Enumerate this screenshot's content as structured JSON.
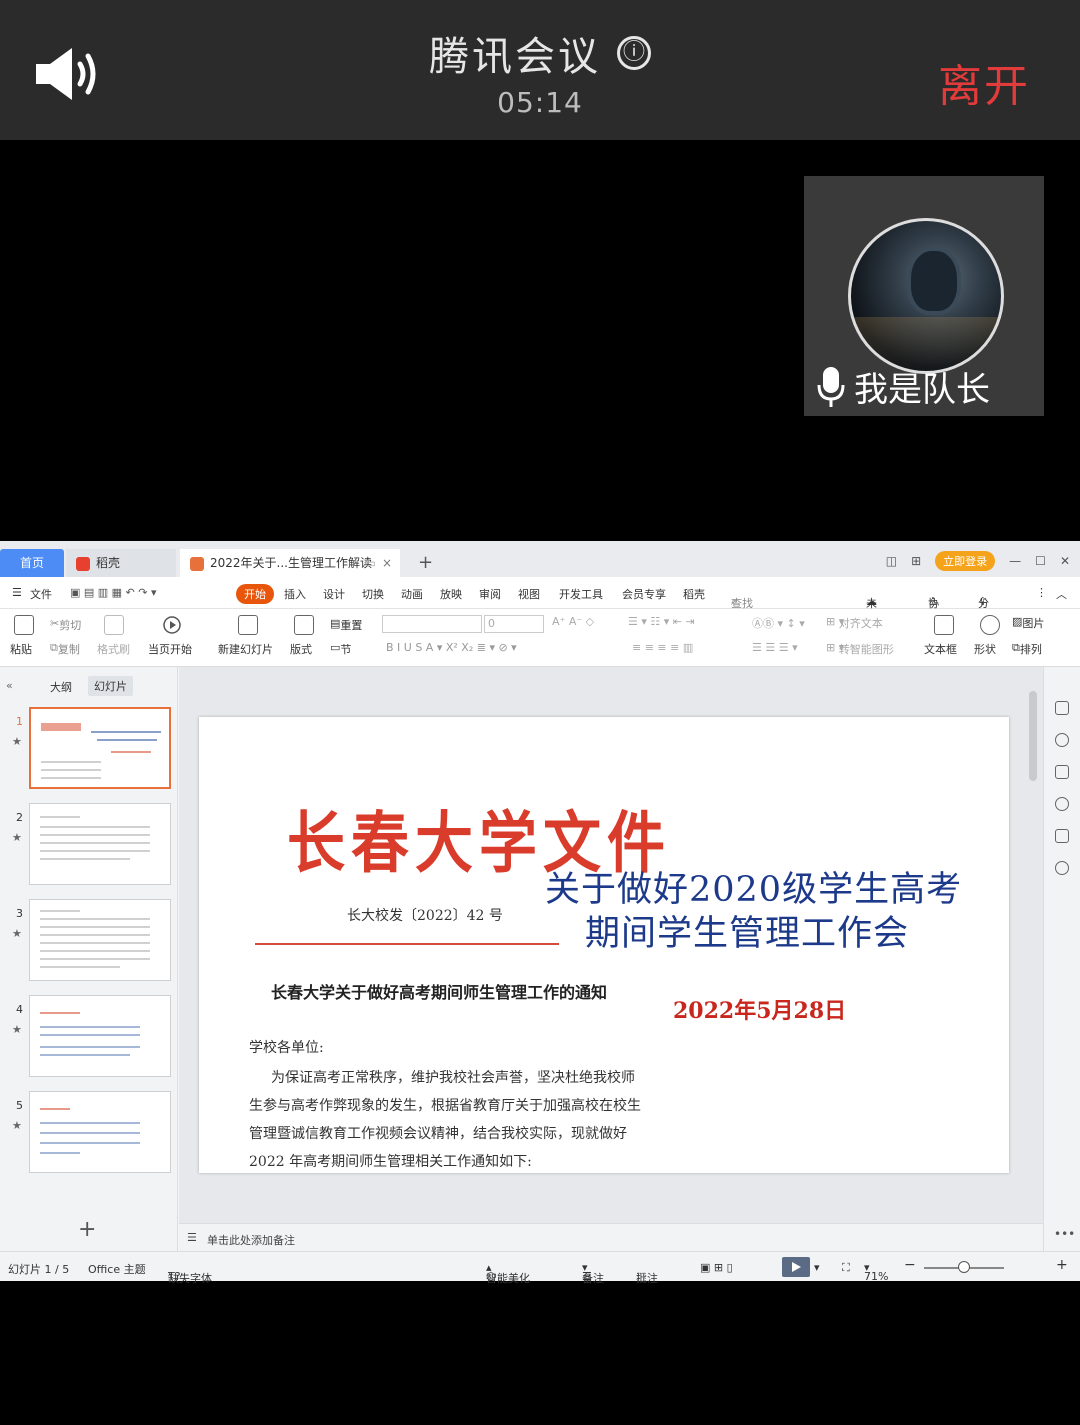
{
  "meeting": {
    "title": "腾讯会议",
    "info_icon": "ⓘ",
    "timer": "05:14",
    "leave_label": "离开"
  },
  "participant": {
    "name": "我是队长"
  },
  "wps": {
    "tabs": {
      "home": "首页",
      "daoke": "稻壳",
      "doc": "2022年关于...生管理工作解读"
    },
    "topright": {
      "login": "立即登录"
    },
    "menu": {
      "file": "文件",
      "start": "开始",
      "insert": "插入",
      "design": "设计",
      "switch": "切换",
      "animation": "动画",
      "show": "放映",
      "review": "审阅",
      "view": "视图",
      "dev": "开发工具",
      "member": "会员专享",
      "daoke": "稻壳",
      "search": "查找命令、搜索...",
      "unsync": "未同步",
      "collab": "协作",
      "share": "分享"
    },
    "ribbon": {
      "paste": "粘贴",
      "cut": "剪切",
      "copy": "复制",
      "format_brush": "格式刷",
      "from_current": "当页开始",
      "new_slide": "新建幻灯片",
      "layout": "版式",
      "reset": "重置",
      "section": "节",
      "font_size": "0",
      "align_text": "对齐文本",
      "smart_shape": "转智能图形",
      "textbox": "文本框",
      "shape": "形状",
      "picture": "图片",
      "arrange": "排列"
    },
    "side": {
      "outline": "大纲",
      "slides": "幻灯片",
      "numbers": [
        "1",
        "2",
        "3",
        "4",
        "5"
      ]
    },
    "slide": {
      "red_header": "长春大学文件",
      "doc_no": "长大校发〔2022〕42 号",
      "subtitle": "长春大学关于做好高考期间师生管理工作的通知",
      "big_title_1": "关于做好2020级学生高考",
      "big_title_2": "期间学生管理工作会",
      "date": "2022年5月28日",
      "body_1": "学校各单位:",
      "body_2": "为保证高考正常秩序，维护我校社会声誉，坚决杜绝我校师",
      "body_3": "生参与高考作弊现象的发生，根据省教育厅关于加强高校在校生",
      "body_4": "管理暨诚信教育工作视频会议精神，结合我校实际，现就做好",
      "body_5": "2022 年高考期间师生管理相关工作通知如下:"
    },
    "notes_placeholder": "单击此处添加备注",
    "status": {
      "slide_counter": "幻灯片 1 / 5",
      "theme": "Office 主题",
      "missing_font": "缺失字体",
      "beautify": "智能美化",
      "notes": "备注",
      "comment": "批注",
      "zoom": "71%"
    }
  }
}
